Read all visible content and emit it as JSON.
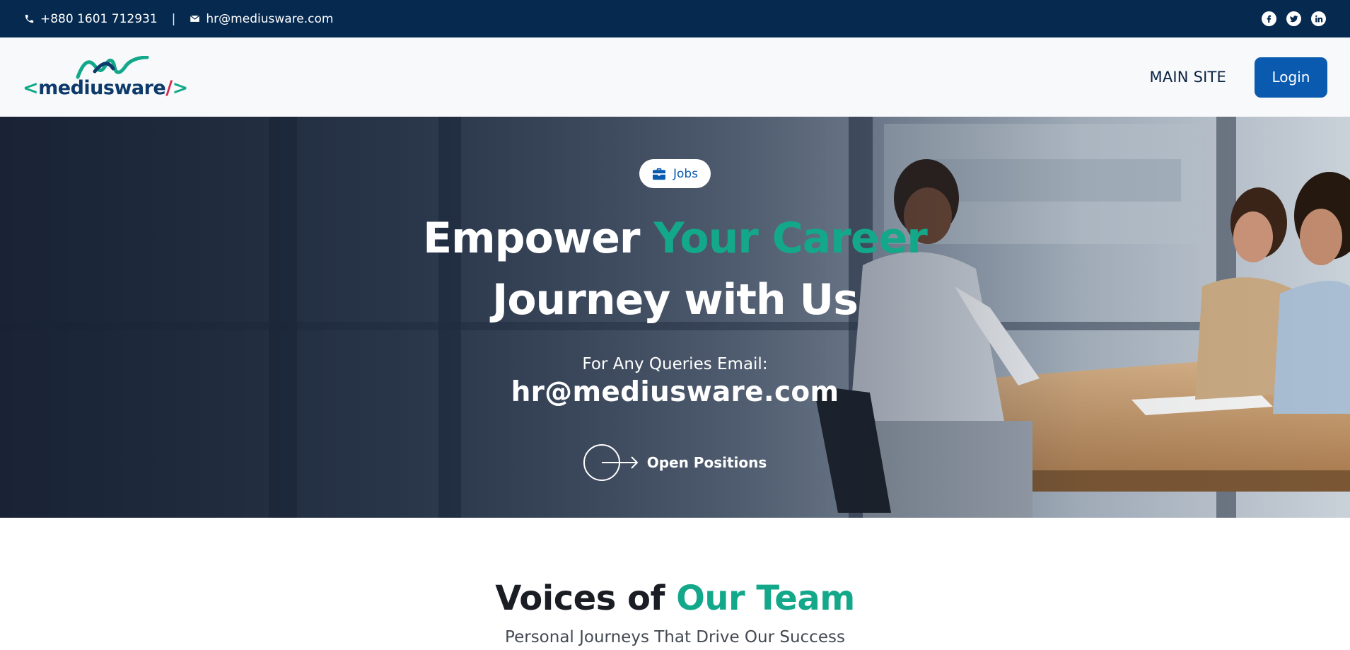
{
  "topbar": {
    "phone": "+880 1601 712931",
    "separator": "|",
    "email": "hr@mediusware.com",
    "socials": [
      "facebook-icon",
      "twitter-icon",
      "linkedin-icon"
    ]
  },
  "brand": {
    "name_part1": "<",
    "name_part2": "mediusware",
    "name_part3": "/",
    "name_part4": ">",
    "colors": {
      "green": "#13a88a",
      "navy": "#0d3a6a",
      "red": "#d62852"
    }
  },
  "nav": {
    "main_site": "MAIN SITE",
    "login": "Login"
  },
  "hero": {
    "pill_label": "Jobs",
    "title_part1": "Empower ",
    "title_accent": "Your Career",
    "title_line2": "Journey with Us",
    "queries_label": "For Any Queries Email:",
    "queries_email": "hr@mediusware.com",
    "cta_label": "Open Positions"
  },
  "voices": {
    "title_part1": "Voices of ",
    "title_accent": "Our Team",
    "subtitle": "Personal Journeys That Drive Our Success"
  },
  "colors": {
    "topbar_bg": "#05294f",
    "accent_green": "#14a88b",
    "button_blue": "#0a5bb0"
  }
}
